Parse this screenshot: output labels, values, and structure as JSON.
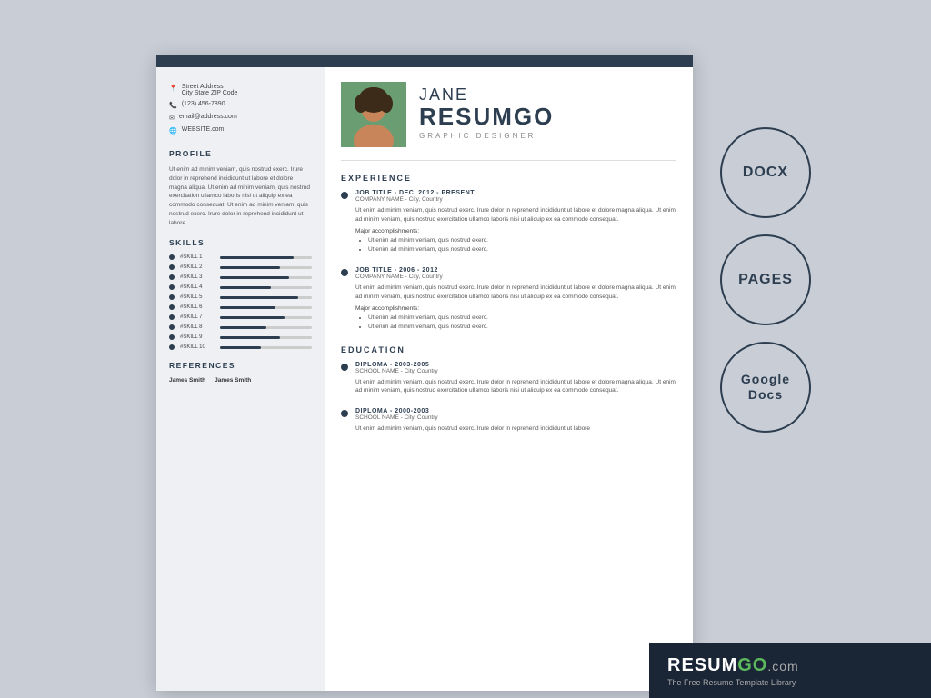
{
  "resume": {
    "header_bar": "",
    "sidebar": {
      "contact": {
        "address_line1": "Street Address",
        "address_line2": "City State ZIP Code",
        "phone": "(123) 456-7890",
        "email": "email@address.com",
        "website": "WEBSITE.com"
      },
      "profile_title": "PROFILE",
      "profile_text": "Ut enim ad minim veniam, quis nostrud exerc. Irure dolor in reprehend incididunt ut labore et dolore magna aliqua. Ut enim ad minim veniam, quis nostrud exercitation ullamco laboris nisi ut aliquip ex ea commodo consequat. Ut enim ad minim veniam, quis nostrud exerc. Irure dolor in reprehend incididunt ut labore",
      "skills_title": "SKILLS",
      "skills": [
        {
          "name": "#SKILL 1",
          "percent": 80
        },
        {
          "name": "#SKILL 2",
          "percent": 65
        },
        {
          "name": "#SKILL 3",
          "percent": 75
        },
        {
          "name": "#SKILL 4",
          "percent": 55
        },
        {
          "name": "#SKILL 5",
          "percent": 85
        },
        {
          "name": "#SKILL 6",
          "percent": 60
        },
        {
          "name": "#SKILL 7",
          "percent": 70
        },
        {
          "name": "#SKILL 8",
          "percent": 50
        },
        {
          "name": "#SKILL 9",
          "percent": 65
        },
        {
          "name": "#SKILL 10",
          "percent": 45
        }
      ],
      "references_title": "REFERENCES",
      "references": [
        "James Smith",
        "James Smith"
      ]
    },
    "main": {
      "first_name": "JANE",
      "last_name": "RESUMGO",
      "job_title": "GRAPHIC DESIGNER",
      "experience_title": "EXPERIENCE",
      "experience": [
        {
          "job_title": "JOB TITLE - DEC. 2012 - PRESENT",
          "company": "COMPANY NAME - City, Country",
          "description": "Ut enim ad minim veniam, quis nostrud exerc. Irure dolor in reprehend incididunt ut labore et dolore magna aliqua. Ut enim ad minim veniam, quis nostrud exercitation ullamco laboris nisi ut aliquip ex ea commodo consequat.",
          "accomplishments_label": "Major accomplishments:",
          "accomplishments": [
            "Ut enim ad minim veniam, quis nostrud exerc.",
            "Ut enim ad minim veniam, quis nostrud exerc."
          ]
        },
        {
          "job_title": "JOB TITLE - 2006 - 2012",
          "company": "COMPANY NAME - City, Country",
          "description": "Ut enim ad minim veniam, quis nostrud exerc. Irure dolor in reprehend incididunt ut labore et dolore magna aliqua. Ut enim ad minim veniam, quis nostrud exercitation ullamco laboris nisi ut aliquip ex ea commodo consequat.",
          "accomplishments_label": "Major accomplishments:",
          "accomplishments": [
            "Ut enim ad minim veniam, quis nostrud exerc.",
            "Ut enim ad minim veniam, quis nostrud exerc."
          ]
        }
      ],
      "education_title": "EDUCATION",
      "education": [
        {
          "degree": "DIPLOMA - 2003-2005",
          "school": "SCHOOL NAME - City, Country",
          "description": "Ut enim ad minim veniam, quis nostrud exerc. Irure dolor in reprehend incididunt ut labore et dolore magna aliqua. Ut enim ad minim veniam, quis nostrud exercitation ullamco laboris nisi ut aliquip ex ea commodo consequat."
        },
        {
          "degree": "DIPLOMA - 2000-2003",
          "school": "SCHOOL NAME - City, Country",
          "description": "Ut enim ad minim veniam, quis nostrud exerc. Irure dolor in reprehend incididunt ut labore"
        }
      ]
    }
  },
  "format_buttons": {
    "docx": "DOCX",
    "pages": "PAGES",
    "google_docs": "Google\nDocs"
  },
  "brand": {
    "name_prefix": "RESUM",
    "name_highlight": "GO",
    "name_suffix": ".com",
    "tagline": "The Free Resume Template Library"
  }
}
